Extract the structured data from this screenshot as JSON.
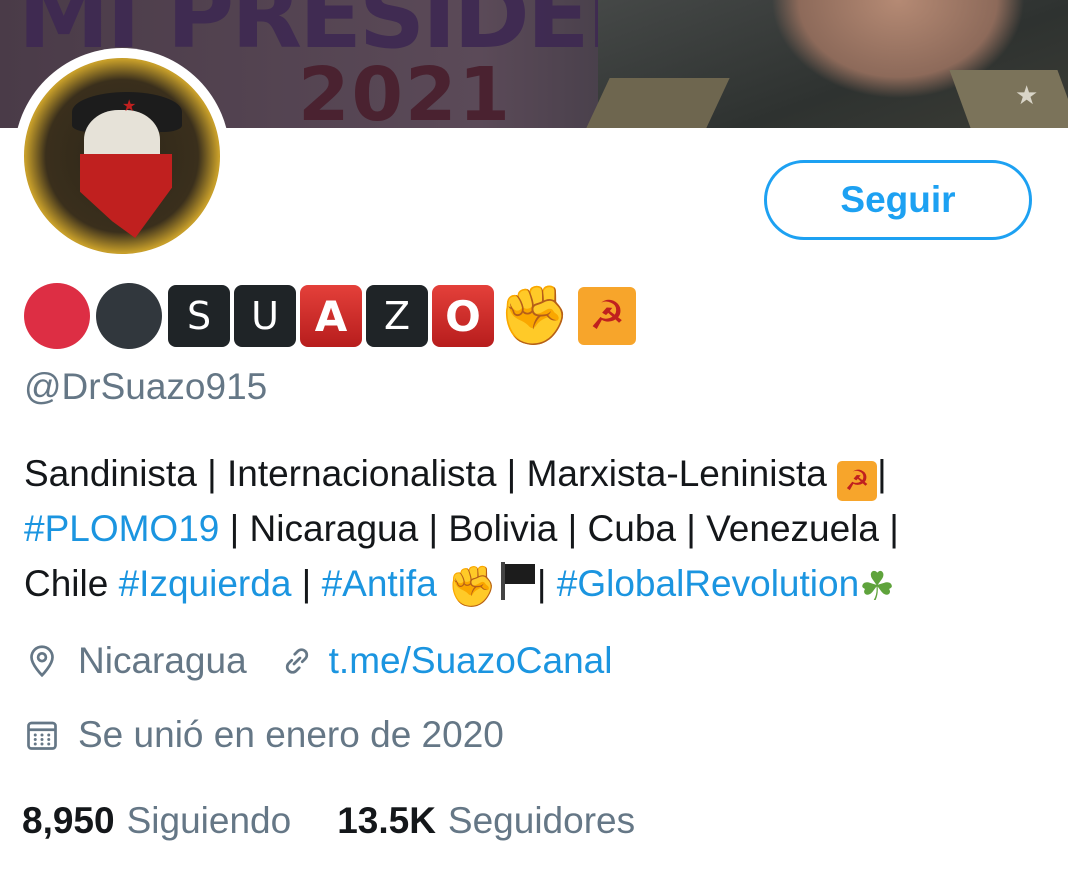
{
  "banner": {
    "line1": "MI PRESIDENTE",
    "line2": "2021"
  },
  "profile": {
    "follow_button": "Seguir",
    "name_letters": [
      "S",
      "U",
      "A",
      "Z",
      "O"
    ],
    "handle": "@DrSuazo915",
    "bio": {
      "line1_text": "Sandinista | Internacionalista | Marxista-Leninista ",
      "line1_end": "|",
      "line2_tag": "#PLOMO19",
      "line2_text": " | Nicaragua | Bolivia | Cuba | Venezuela |",
      "line3_text": "Chile ",
      "line3_tag1": "#Izquierda",
      "line3_sep1": " | ",
      "line3_tag2": "#Antifa",
      "line3_sep2": "| ",
      "line3_tag3": "#GlobalRevolution"
    },
    "location": "Nicaragua",
    "website": "t.me/SuazoCanal",
    "joined": "Se unió en enero de 2020",
    "following_count": "8,950",
    "following_label": "Siguiendo",
    "followers_count": "13.5K",
    "followers_label": "Seguidores"
  },
  "icons": {
    "location": "location-pin-icon",
    "link": "link-icon",
    "calendar": "calendar-icon",
    "hammer_sickle": "hammer-sickle-icon",
    "fist": "raised-fist-icon",
    "flag": "black-flag-icon",
    "clover": "shamrock-icon"
  },
  "colors": {
    "accent": "#1da1f2",
    "secondary_text": "#657786",
    "primary_text": "#14171a"
  }
}
